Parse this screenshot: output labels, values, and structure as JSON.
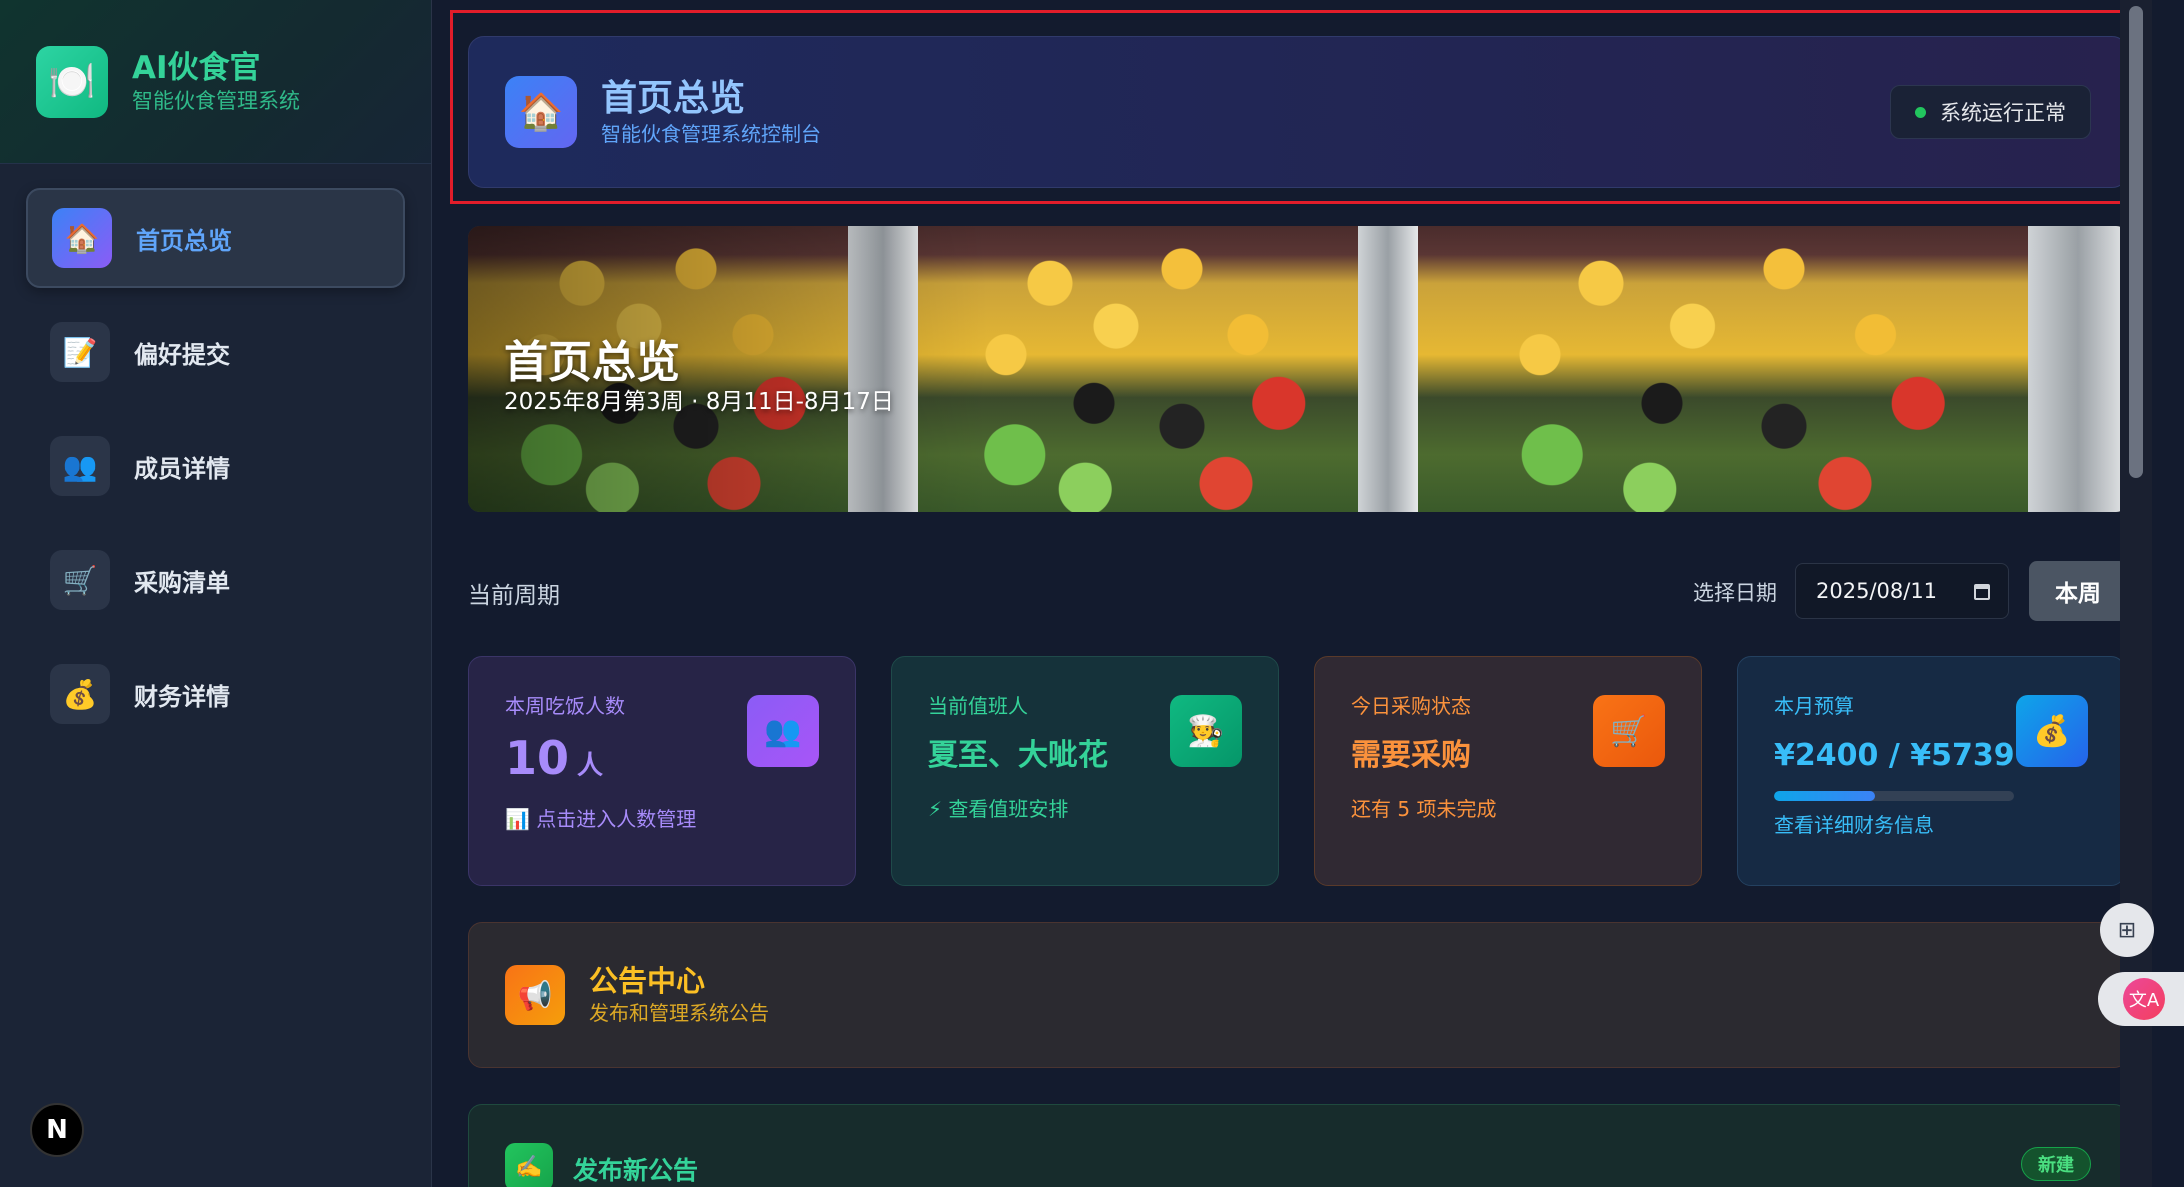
{
  "brand": {
    "title": "AI伙食官",
    "subtitle": "智能伙食管理系统",
    "logo_icon": "🍽️"
  },
  "sidebar": {
    "items": [
      {
        "label": "首页总览",
        "icon": "🏠",
        "active": true
      },
      {
        "label": "偏好提交",
        "icon": "📝",
        "active": false
      },
      {
        "label": "成员详情",
        "icon": "👥",
        "active": false
      },
      {
        "label": "采购清单",
        "icon": "🛒",
        "active": false
      },
      {
        "label": "财务详情",
        "icon": "💰",
        "active": false
      }
    ],
    "bottom_badge": "N"
  },
  "header": {
    "icon": "🏠",
    "title": "首页总览",
    "subtitle": "智能伙食管理系统控制台",
    "status": "系统运行正常"
  },
  "banner": {
    "title": "首页总览",
    "subtitle": "2025年8月第3周 · 8月11日-8月17日"
  },
  "period": {
    "label": "当前周期",
    "date_label": "选择日期",
    "date_value": "2025/08/11",
    "week_button": "本周"
  },
  "stats": [
    {
      "label": "本周吃饭人数",
      "value": "10",
      "unit": "人",
      "link": "点击进入人数管理",
      "link_icon": "📊",
      "icon": "👥"
    },
    {
      "label": "当前值班人",
      "value": "夏至、大呲花",
      "link": "查看值班安排",
      "link_icon": "⚡",
      "icon": "🧑‍🍳"
    },
    {
      "label": "今日采购状态",
      "value": "需要采购",
      "link": "还有 5 项未完成",
      "icon": "🛒"
    },
    {
      "label": "本月预算",
      "value": "¥2400 / ¥5739",
      "link": "查看详细财务信息",
      "icon": "💰",
      "progress": 0.42
    }
  ],
  "notice": {
    "icon": "📢",
    "title": "公告中心",
    "subtitle": "发布和管理系统公告"
  },
  "publish": {
    "icon": "✍️",
    "title": "发布新公告",
    "badge": "新建"
  },
  "floating": {
    "tool_icon": "⊞",
    "translate_icon": "文A"
  },
  "colors": {
    "accent_blue": "#60a5fa",
    "accent_green": "#34d399",
    "accent_purple": "#a78bfa",
    "accent_orange": "#fb923c",
    "accent_sky": "#38bdf8",
    "status_ok": "#22c55e",
    "highlight_outline": "#e11d2a"
  }
}
